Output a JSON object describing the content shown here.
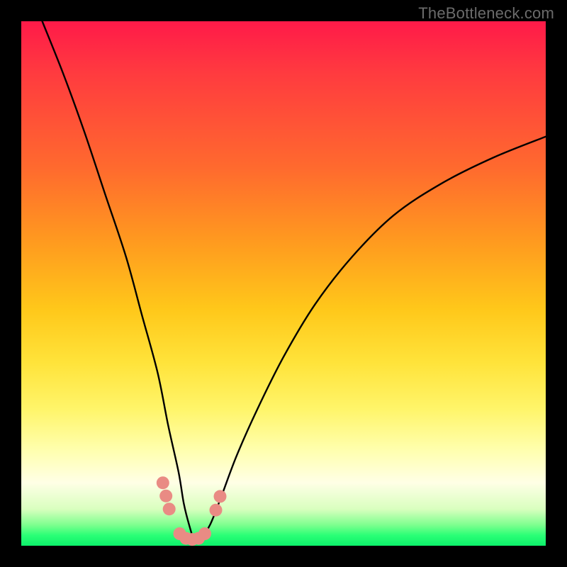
{
  "watermark": "TheBottleneck.com",
  "chart_data": {
    "type": "line",
    "title": "",
    "xlabel": "",
    "ylabel": "",
    "xlim": [
      0,
      100
    ],
    "ylim": [
      0,
      100
    ],
    "legend": false,
    "grid": false,
    "series": [
      {
        "name": "bottleneck-curve",
        "color": "#000000",
        "x": [
          4,
          8,
          12,
          16,
          20,
          23,
          26,
          28,
          30,
          31,
          32,
          33,
          34,
          36,
          38,
          41,
          45,
          50,
          56,
          63,
          71,
          80,
          90,
          100
        ],
        "values": [
          100,
          90,
          79,
          67,
          55,
          44,
          33,
          23,
          14,
          8,
          4,
          1,
          1,
          4,
          9,
          17,
          26,
          36,
          46,
          55,
          63,
          69,
          74,
          78
        ]
      }
    ],
    "markers": {
      "name": "highlight-dots",
      "color": "#e98b84",
      "radius_px": 9,
      "points": [
        {
          "x": 27.0,
          "y": 12.0
        },
        {
          "x": 27.6,
          "y": 9.5
        },
        {
          "x": 28.2,
          "y": 7.0
        },
        {
          "x": 30.2,
          "y": 2.3
        },
        {
          "x": 31.4,
          "y": 1.4
        },
        {
          "x": 32.6,
          "y": 1.2
        },
        {
          "x": 33.8,
          "y": 1.4
        },
        {
          "x": 35.0,
          "y": 2.3
        },
        {
          "x": 37.1,
          "y": 6.8
        },
        {
          "x": 37.9,
          "y": 9.4
        }
      ]
    }
  }
}
